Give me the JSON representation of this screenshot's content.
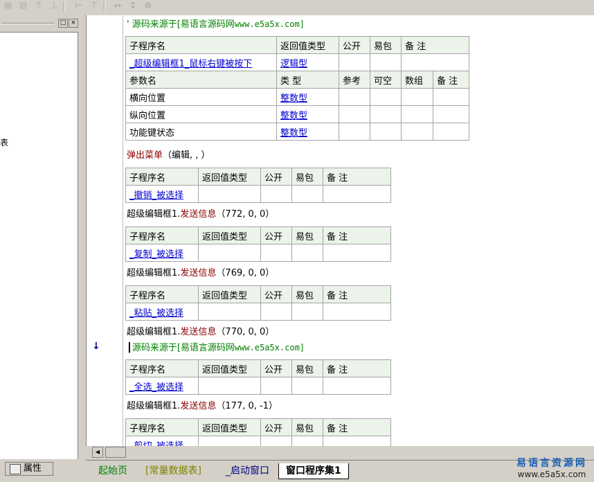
{
  "toolbar": {
    "icons": [
      "align-left-icon",
      "align-center-icon",
      "align-top-icon",
      "align-bottom-icon",
      "equal-width-icon",
      "equal-height-icon",
      "width-icon",
      "height-icon",
      "size-icon"
    ]
  },
  "left_panel": {
    "partial_text": "表",
    "buttons": {
      "restore": "□",
      "close": "×"
    }
  },
  "property_tab": {
    "label": "属性"
  },
  "editor": {
    "comment_prefix": "'",
    "comment_text": "源码来源于[易语言源码网",
    "comment_url": "www.e5a5x.com]",
    "arrow_symbol": "↓",
    "main_table": {
      "headers": [
        "子程序名",
        "返回值类型",
        "公开",
        "易包",
        "备 注"
      ],
      "name": "_超级编辑框1_鼠标右键被按下",
      "return_type": "逻辑型",
      "param_headers": [
        "参数名",
        "类 型",
        "参考",
        "可空",
        "数组",
        "备 注"
      ],
      "params": [
        {
          "name": "横向位置",
          "type": "整数型"
        },
        {
          "name": "纵向位置",
          "type": "整数型"
        },
        {
          "name": "功能键状态",
          "type": "整数型"
        }
      ]
    },
    "popup_line": {
      "func": "弹出菜单",
      "args": "（编辑, , ）"
    },
    "sub_headers": [
      "子程序名",
      "返回值类型",
      "公开",
      "易包",
      "备 注"
    ],
    "subs": [
      {
        "name": "_撤销_被选择",
        "obj": "超级编辑框1.",
        "method": "发送信息",
        "args": "（772, 0, 0）"
      },
      {
        "name": "_复制_被选择",
        "obj": "超级编辑框1.",
        "method": "发送信息",
        "args": "（769, 0, 0）"
      },
      {
        "name": "_粘贴_被选择",
        "obj": "超级编辑框1.",
        "method": "发送信息",
        "args": "（770, 0, 0）"
      },
      {
        "name": "_全选_被选择",
        "obj": "超级编辑框1.",
        "method": "发送信息",
        "args": "（177, 0, -1）"
      },
      {
        "name": "_剪切_被选择"
      }
    ]
  },
  "tabs": [
    {
      "label": "起始页",
      "color": "#008000"
    },
    {
      "label": "[常量数据表]",
      "color": "#808000"
    },
    {
      "label": "_启动窗口",
      "color": "#000080"
    },
    {
      "label": "窗口程序集1",
      "color": "#000000"
    }
  ],
  "watermark": {
    "line1": "易语言资源网",
    "line2": "www.e5a5x.com"
  }
}
